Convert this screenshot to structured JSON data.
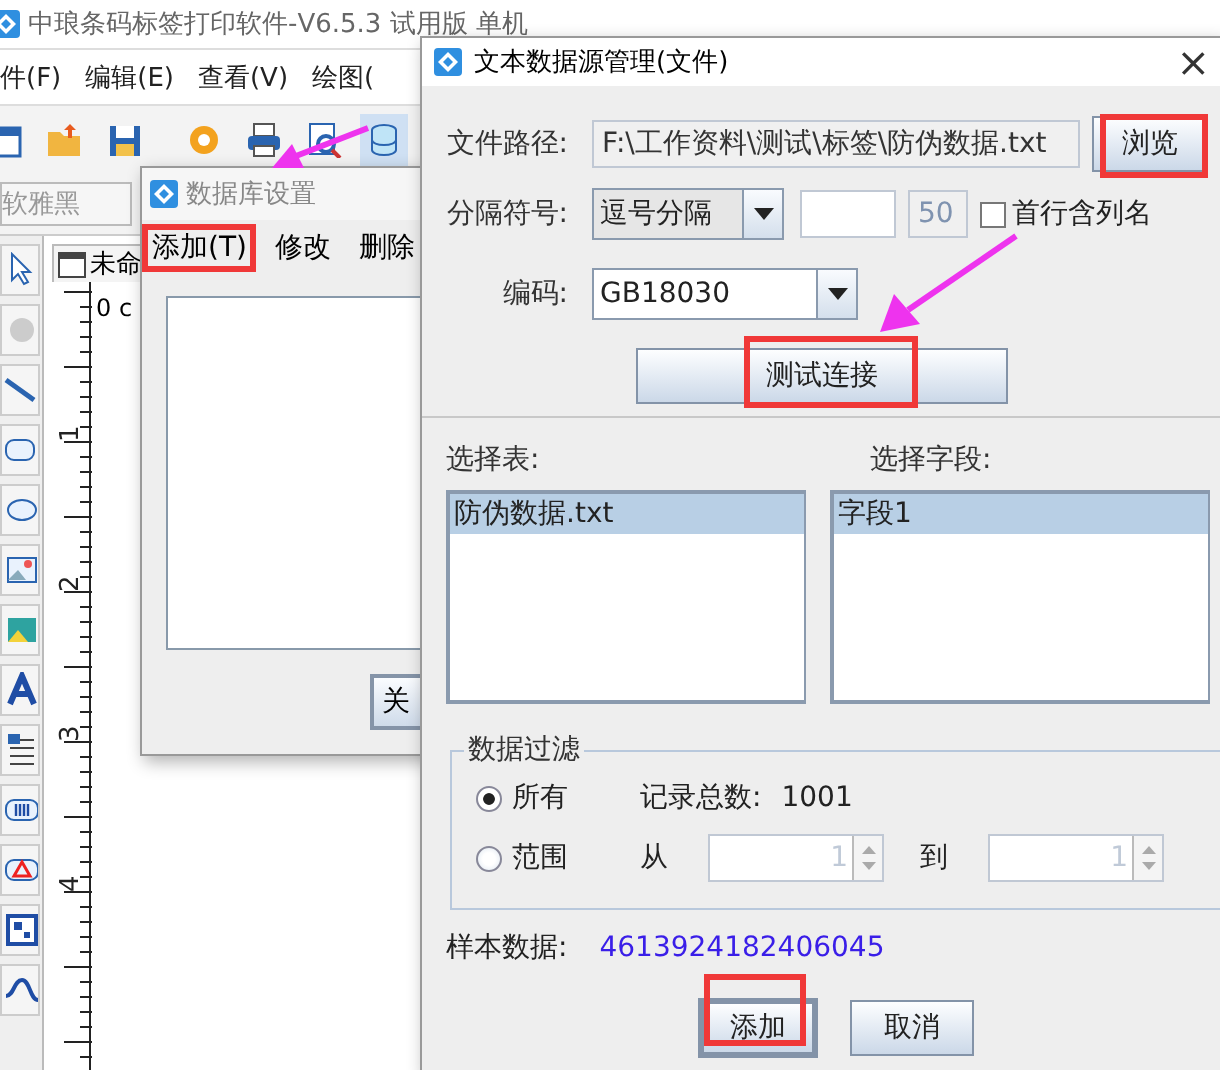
{
  "app": {
    "title": "中琅条码标签打印软件-V6.5.3 试用版 单机",
    "menu": [
      "件(F)",
      "编辑(E)",
      "查看(V)",
      "绘图("
    ],
    "font": "软雅黑",
    "doc_tab": "未命",
    "ruler": {
      "origin": "0 c",
      "marks": [
        "1",
        "2",
        "3",
        "4"
      ]
    }
  },
  "db_dialog": {
    "title": "数据库设置",
    "menu": [
      {
        "label": "添加(T)",
        "highlighted": true
      },
      {
        "label": "修改",
        "highlighted": false
      },
      {
        "label": "删除",
        "highlighted": false
      }
    ],
    "button": "关"
  },
  "file_dialog": {
    "title": "文本数据源管理(文件)",
    "close": "×",
    "path": {
      "label": "文件路径:",
      "value": "F:\\工作资料\\测试\\标签\\防伪数据.txt",
      "browse": {
        "label": "浏览",
        "highlighted": true
      }
    },
    "separator": {
      "label": "分隔符号:",
      "value": "逗号分隔",
      "max": "50",
      "header_checkbox": {
        "label": "首行含列名",
        "checked": false
      }
    },
    "encoding": {
      "label": "编码:",
      "value": "GB18030"
    },
    "test_button": {
      "label": "测试连接",
      "highlighted": true
    },
    "tables": {
      "label": "选择表:",
      "items": [
        {
          "label": "防伪数据.txt",
          "selected": true
        }
      ]
    },
    "fields": {
      "label": "选择字段:",
      "items": [
        {
          "label": "字段1",
          "selected": true
        }
      ]
    },
    "filter": {
      "title": "数据过滤",
      "options": [
        {
          "label": "所有",
          "selected": true
        },
        {
          "label": "范围",
          "selected": false
        }
      ],
      "count_label": "记录总数:",
      "count": "1001",
      "from_label": "从",
      "from": "1",
      "to_label": "到",
      "to": "1"
    },
    "sample": {
      "label": "样本数据:",
      "value": "4613924182406045"
    },
    "buttons": [
      {
        "label": "添加",
        "highlighted": true,
        "focused": true
      },
      {
        "label": "取消",
        "highlighted": false,
        "focused": false
      }
    ]
  }
}
